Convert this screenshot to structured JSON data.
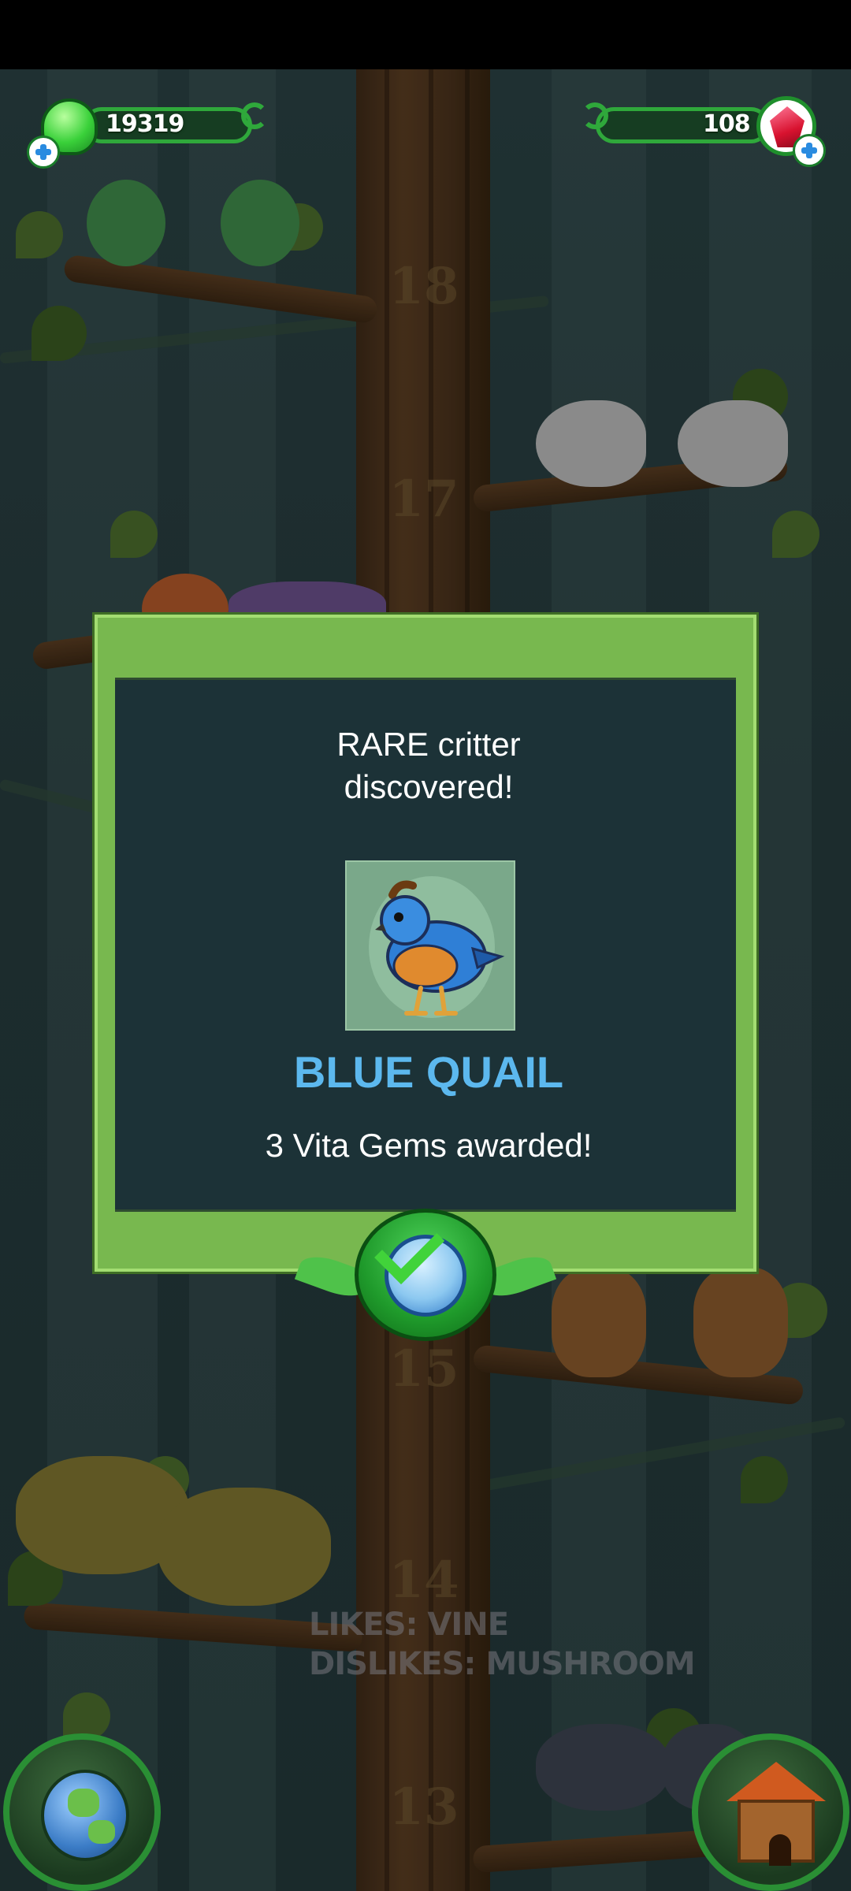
{
  "hud": {
    "jelly_count": "19319",
    "gem_count": "108"
  },
  "tree": {
    "levels": [
      "18",
      "17",
      "15",
      "14",
      "13"
    ]
  },
  "dialog": {
    "title_line1": "RARE critter",
    "title_line2": "discovered!",
    "critter_name": "BLUE QUAIL",
    "award_text": "3 Vita Gems awarded!"
  },
  "hint": {
    "likes": "LIKES: VINE",
    "dislikes": "DISLIKES: MUSHROOM"
  },
  "colors": {
    "accent_green": "#2fa83b",
    "dialog_green": "#78b84f",
    "critter_name_blue": "#5cb8ee",
    "dialog_bg": "#1c3237"
  },
  "icons": {
    "jelly": "green-jelly-icon",
    "gem": "red-gem-icon",
    "plus": "plus-icon",
    "confirm": "checkmark-icon",
    "map": "globe-icon",
    "home": "house-icon"
  }
}
